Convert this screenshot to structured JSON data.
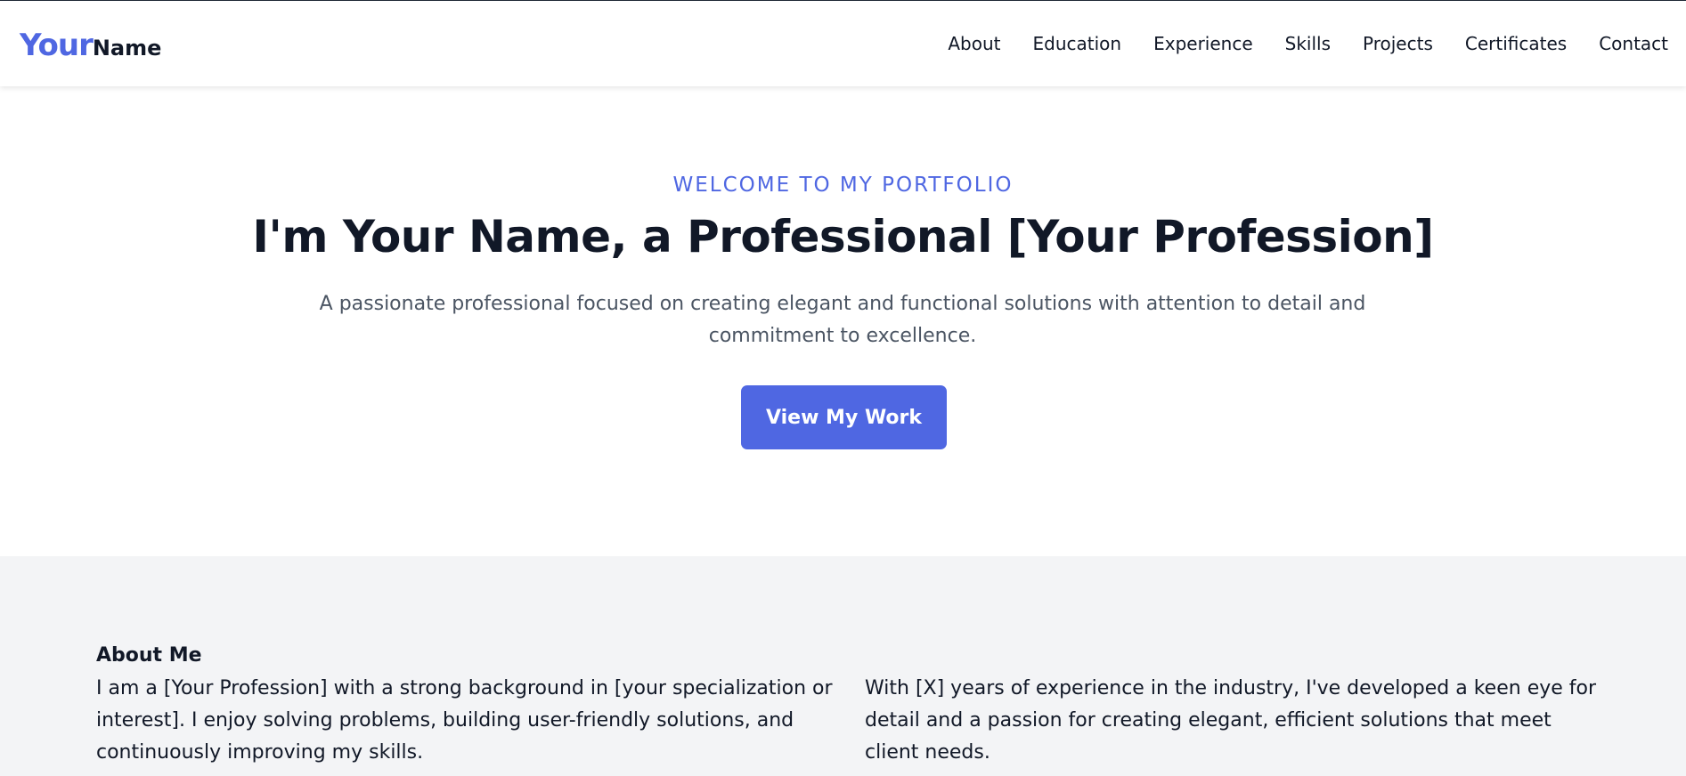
{
  "brand": {
    "first": "Your",
    "second": "Name",
    "accent_color": "#4f67e2"
  },
  "nav": {
    "items": [
      {
        "label": "About"
      },
      {
        "label": "Education"
      },
      {
        "label": "Experience"
      },
      {
        "label": "Skills"
      },
      {
        "label": "Projects"
      },
      {
        "label": "Certificates"
      },
      {
        "label": "Contact"
      }
    ]
  },
  "hero": {
    "eyebrow": "WELCOME TO MY PORTFOLIO",
    "title": "I'm Your Name, a Professional [Your Profession]",
    "description": "A passionate professional focused on creating elegant and functional solutions with attention to detail and commitment to excellence.",
    "cta_label": "View My Work"
  },
  "about": {
    "heading": "About Me",
    "paragraphs": [
      "I am a [Your Profession] with a strong background in [your specialization or interest]. I enjoy solving problems, building user-friendly solutions, and continuously improving my skills.",
      "With [X] years of experience in the industry, I've developed a keen eye for detail and a passion for creating elegant, efficient solutions that meet client needs."
    ]
  },
  "colors": {
    "accent": "#4f67e2",
    "text_dark": "#111827",
    "text_muted": "#4b5563",
    "about_bg": "#f3f4f6"
  }
}
